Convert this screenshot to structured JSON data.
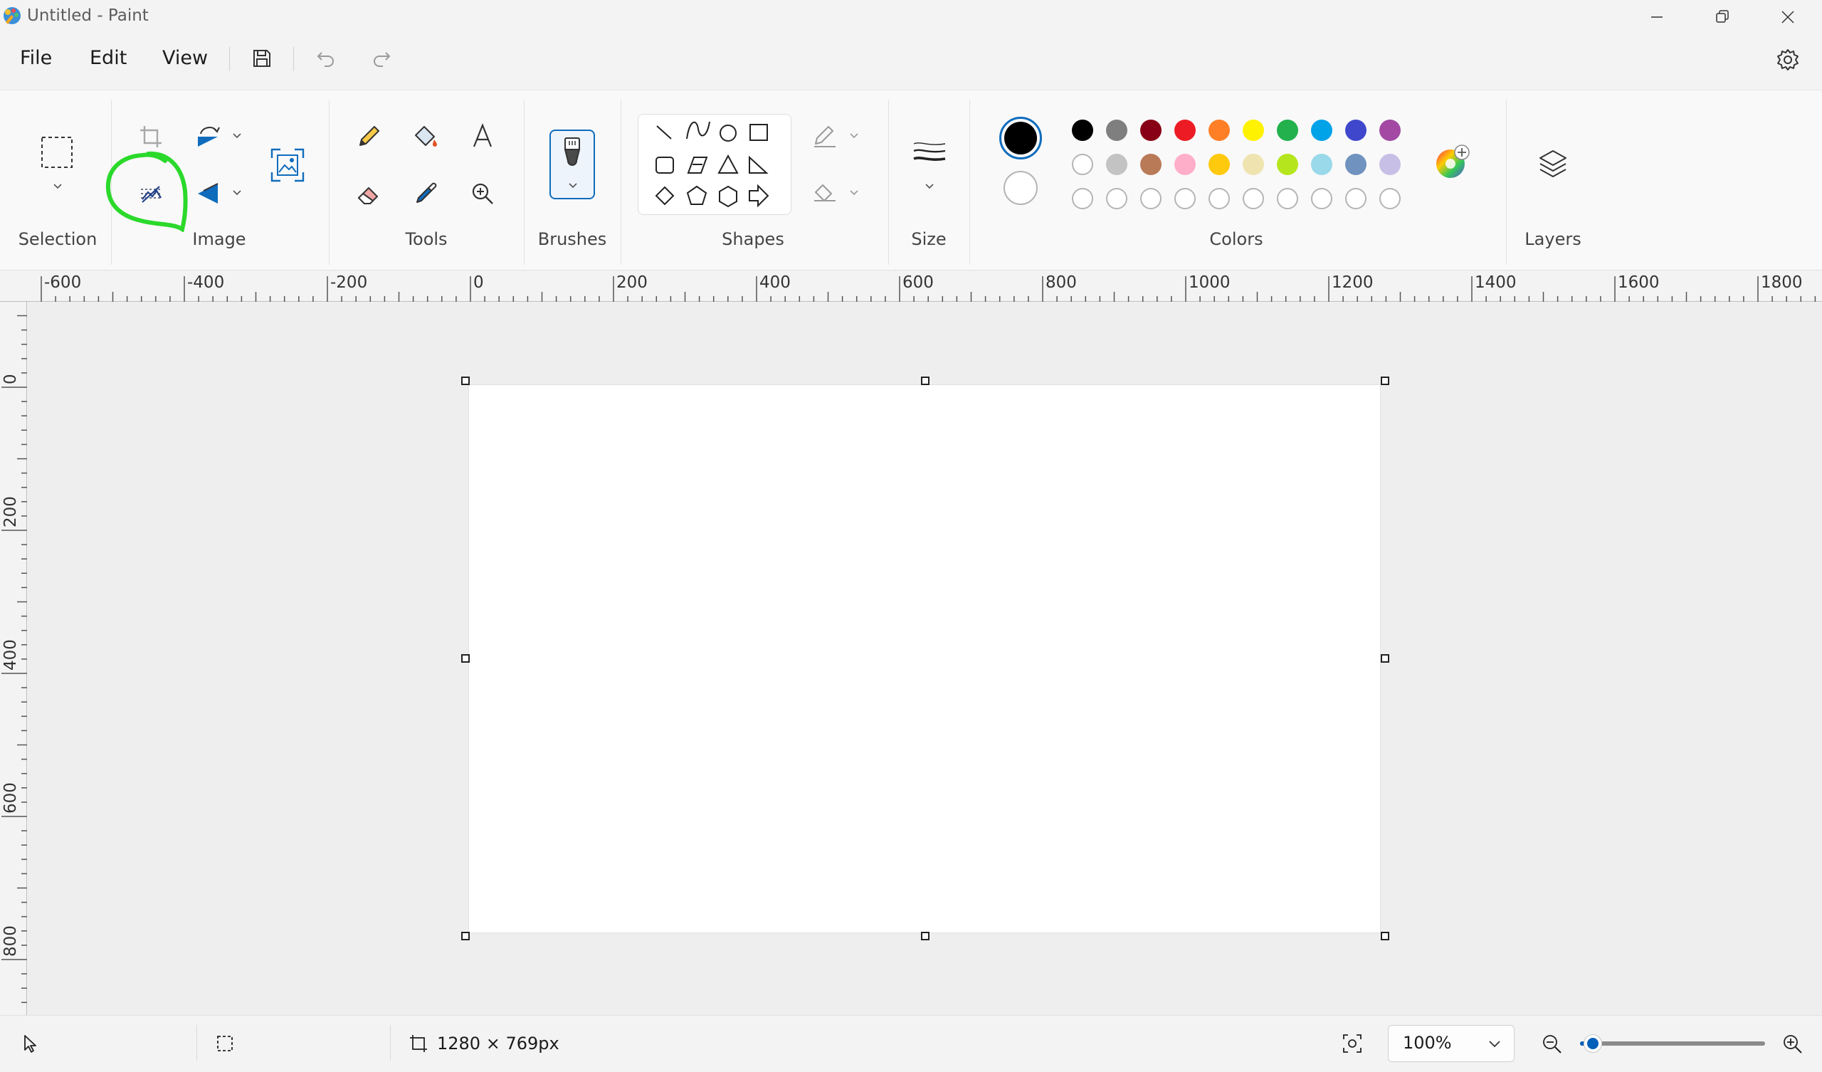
{
  "window": {
    "title": "Untitled - Paint"
  },
  "menu": {
    "file": "File",
    "edit": "Edit",
    "view": "View"
  },
  "ribbon": {
    "groups": {
      "selection": "Selection",
      "image": "Image",
      "tools": "Tools",
      "brushes": "Brushes",
      "shapes": "Shapes",
      "size": "Size",
      "colors": "Colors",
      "layers": "Layers"
    },
    "highlighted_tool": "remove-background",
    "annotation_color": "#2bd92b"
  },
  "colors": {
    "primary": "#000000",
    "secondary": "#ffffff",
    "palette_row1": [
      "#000000",
      "#7f7f7f",
      "#880015",
      "#ed1c24",
      "#ff7f27",
      "#fff200",
      "#22b14c",
      "#00a2e8",
      "#3f48cc",
      "#a349a4"
    ],
    "palette_row2": [
      "#ffffff",
      "#c3c3c3",
      "#b97a57",
      "#ffaec9",
      "#ffc90e",
      "#efe4b0",
      "#b5e61d",
      "#99d9ea",
      "#7092be",
      "#c8bfe7"
    ],
    "palette_row3": [
      "",
      "",
      "",
      "",
      "",
      "",
      "",
      "",
      "",
      ""
    ]
  },
  "rulers": {
    "horizontal": [
      "-600",
      "-400",
      "-200",
      "0",
      "200",
      "400",
      "600",
      "800",
      "1000",
      "1200",
      "1400",
      "1600",
      "1800"
    ],
    "vertical": [
      "0",
      "200",
      "400",
      "600",
      "800"
    ]
  },
  "status": {
    "canvas_size": "1280 × 769px",
    "zoom": "100%",
    "zoom_fraction": 0.07
  }
}
